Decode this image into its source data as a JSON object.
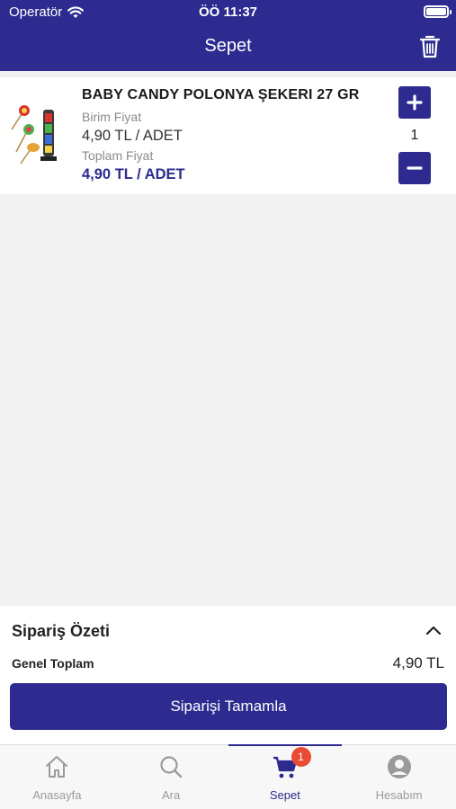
{
  "status_bar": {
    "carrier": "Operatör",
    "time": "ÖÖ 11:37"
  },
  "header": {
    "title": "Sepet"
  },
  "cart": {
    "items": [
      {
        "name": "BABY CANDY POLONYA ŞEKERI 27 GR",
        "unit_price_label": "Birim Fiyat",
        "unit_price": "4,90 TL / ADET",
        "total_price_label": "Toplam Fiyat",
        "total_price": "4,90 TL / ADET",
        "quantity": "1"
      }
    ]
  },
  "summary": {
    "title": "Sipariş Özeti",
    "grand_total_label": "Genel Toplam",
    "grand_total_value": "4,90 TL",
    "complete_button": "Siparişi Tamamla"
  },
  "tabbar": {
    "tabs": [
      {
        "label": "Anasayfa",
        "icon": "home-icon"
      },
      {
        "label": "Ara",
        "icon": "search-icon"
      },
      {
        "label": "Sepet",
        "icon": "cart-icon",
        "badge": "1",
        "active": true
      },
      {
        "label": "Hesabım",
        "icon": "account-icon"
      }
    ]
  },
  "colors": {
    "primary": "#2d2b8f",
    "badge": "#e94b35",
    "muted_text": "#8a8a8a"
  }
}
